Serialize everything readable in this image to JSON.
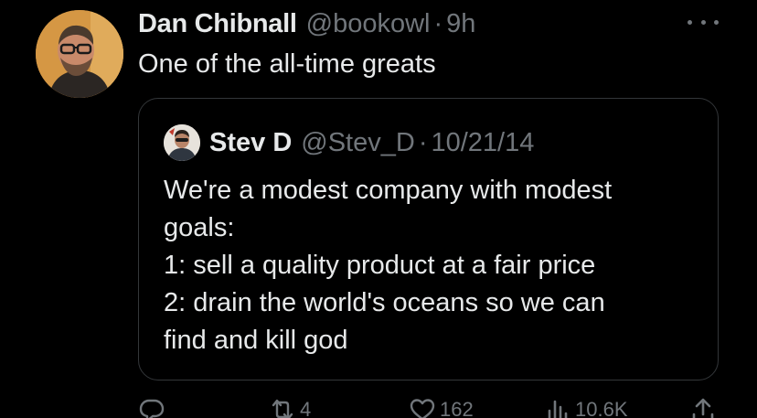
{
  "tweet": {
    "author_name": "Dan Chibnall",
    "author_handle": "@bookowl",
    "separator": "·",
    "time": "9h",
    "text": "One of the all-time greats"
  },
  "quoted": {
    "author_name": "Stev D",
    "author_handle": "@Stev_D",
    "separator": "·",
    "date": "10/21/14",
    "lines": [
      "We're a modest company with modest",
      "goals:",
      "1: sell a quality product at a fair price",
      "2: drain the world's oceans so we can",
      "find and kill god"
    ]
  },
  "actions": {
    "reply_icon": "reply-icon",
    "retweet_icon": "retweet-icon",
    "retweet_count": "4",
    "like_icon": "heart-icon",
    "like_count": "162",
    "views_icon": "views-icon",
    "views_count": "10.6K",
    "share_icon": "share-icon"
  },
  "colors": {
    "background": "#000000",
    "primary_text": "#e7e9ea",
    "secondary_text": "#71767b",
    "border": "#333639"
  }
}
